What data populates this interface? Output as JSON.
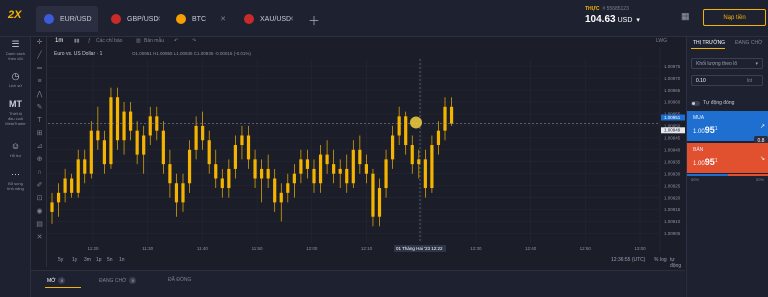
{
  "app": {
    "logo": "2X"
  },
  "tabs": [
    {
      "label": "EUR/USD",
      "flag_color": "#3b5bdb",
      "active": true
    },
    {
      "label": "GBP/USD",
      "flag_color": "#c92a2a",
      "active": false
    },
    {
      "label": "BTC",
      "flag_color": "#f59f00",
      "active": false
    },
    {
      "label": "XAU/USD",
      "flag_color": "#c92a2a",
      "active": false
    }
  ],
  "account": {
    "mode": "THỰC",
    "id": "# 55685123",
    "balance": "104.63",
    "currency": "USD",
    "deposit_label": "Nạp tiền"
  },
  "sidebar": [
    {
      "icon": "list-icon",
      "glyph": "☰",
      "label1": "Danh sách",
      "label2": "theo dõi"
    },
    {
      "icon": "history-icon",
      "glyph": "◷",
      "label1": "Lịch sử",
      "label2": ""
    },
    {
      "icon": "metatrader-icon",
      "glyph": "MT",
      "label1": "Thiết bị",
      "label2": "đầu cuối MetaTrader"
    },
    {
      "icon": "support-icon",
      "glyph": "☺",
      "label1": "Hỗ trợ",
      "label2": ""
    },
    {
      "icon": "more-icon",
      "glyph": "⋯",
      "label1": "Bổ sung",
      "label2": "tính năng"
    }
  ],
  "chart_toolbar": {
    "timeframe": "1m",
    "chart_style": "Các chỉ báo",
    "templates": "Bản mẫu",
    "ohlc": "O1.00951 H1.00955 L1.00935 C1.00935 -0.00015 (-0.01%)",
    "symbol_name": "Euro vs. US Dollar · 1",
    "log_label": "LWG"
  },
  "chart_data": {
    "type": "candlestick",
    "symbol": "Euro vs. US Dollar",
    "interval": "1",
    "y_ticks": [
      "1.00975",
      "1.00970",
      "1.00965",
      "1.00960",
      "1.00955",
      "1.00950",
      "1.00945",
      "1.00940",
      "1.00935",
      "1.00930",
      "1.00925",
      "1.00920",
      "1.00915",
      "1.00910",
      "1.00905"
    ],
    "x_ticks": [
      "11:20",
      "11:30",
      "11:40",
      "11:50",
      "12:00",
      "12:10",
      "12:20",
      "12:30",
      "12:40",
      "12:50",
      "13:00"
    ],
    "ylim": [
      1.00901,
      1.00978
    ],
    "current_price_label": "1.00949",
    "crosshair_price_label": "1.00951",
    "crosshair_time_label": "01 Tháng Hai '23",
    "crosshair_time2": "12:22",
    "candle_color": "#f4b400",
    "ohlc": [
      [
        1.00914,
        1.00922,
        1.00909,
        1.00918
      ],
      [
        1.00918,
        1.00926,
        1.00912,
        1.00922
      ],
      [
        1.00922,
        1.00932,
        1.00918,
        1.00928
      ],
      [
        1.00928,
        1.0093,
        1.0092,
        1.00922
      ],
      [
        1.00922,
        1.0094,
        1.0092,
        1.00936
      ],
      [
        1.00936,
        1.0094,
        1.00926,
        1.0093
      ],
      [
        1.0093,
        1.00952,
        1.00928,
        1.00948
      ],
      [
        1.00948,
        1.00958,
        1.0094,
        1.00944
      ],
      [
        1.00944,
        1.00948,
        1.0093,
        1.00934
      ],
      [
        1.00934,
        1.00966,
        1.00932,
        1.00962
      ],
      [
        1.00962,
        1.00966,
        1.0094,
        1.00944
      ],
      [
        1.00944,
        1.0096,
        1.00938,
        1.00956
      ],
      [
        1.00956,
        1.0096,
        1.00944,
        1.00948
      ],
      [
        1.00948,
        1.00952,
        1.00934,
        1.00938
      ],
      [
        1.00938,
        1.0095,
        1.0093,
        1.00946
      ],
      [
        1.00946,
        1.00958,
        1.00942,
        1.00954
      ],
      [
        1.00954,
        1.00958,
        1.00944,
        1.00948
      ],
      [
        1.00948,
        1.00952,
        1.0093,
        1.00934
      ],
      [
        1.00934,
        1.0094,
        1.0092,
        1.00926
      ],
      [
        1.00926,
        1.0093,
        1.00912,
        1.00918
      ],
      [
        1.00918,
        1.0093,
        1.00914,
        1.00926
      ],
      [
        1.00926,
        1.00944,
        1.00922,
        1.0094
      ],
      [
        1.0094,
        1.00954,
        1.00936,
        1.0095
      ],
      [
        1.0095,
        1.00956,
        1.0094,
        1.00944
      ],
      [
        1.00944,
        1.00948,
        1.0093,
        1.00934
      ],
      [
        1.00934,
        1.0094,
        1.00924,
        1.00928
      ],
      [
        1.00928,
        1.00932,
        1.0092,
        1.00924
      ],
      [
        1.00924,
        1.00936,
        1.0092,
        1.00932
      ],
      [
        1.00932,
        1.00946,
        1.00928,
        1.00942
      ],
      [
        1.00942,
        1.0095,
        1.00936,
        1.00946
      ],
      [
        1.00946,
        1.0095,
        1.00932,
        1.00936
      ],
      [
        1.00936,
        1.0094,
        1.00924,
        1.00928
      ],
      [
        1.00928,
        1.00936,
        1.00918,
        1.00932
      ],
      [
        1.00932,
        1.00938,
        1.00924,
        1.00928
      ],
      [
        1.00928,
        1.00932,
        1.00914,
        1.00918
      ],
      [
        1.00918,
        1.00926,
        1.0091,
        1.00922
      ],
      [
        1.00922,
        1.0093,
        1.00918,
        1.00926
      ],
      [
        1.00926,
        1.00934,
        1.0092,
        1.0093
      ],
      [
        1.0093,
        1.0094,
        1.00926,
        1.00936
      ],
      [
        1.00936,
        1.0094,
        1.00928,
        1.00932
      ],
      [
        1.00932,
        1.00936,
        1.00922,
        1.00926
      ],
      [
        1.00926,
        1.00942,
        1.00922,
        1.00938
      ],
      [
        1.00938,
        1.00944,
        1.0093,
        1.00934
      ],
      [
        1.00934,
        1.0094,
        1.00926,
        1.0093
      ],
      [
        1.0093,
        1.00936,
        1.00924,
        1.00932
      ],
      [
        1.00932,
        1.00938,
        1.00922,
        1.00926
      ],
      [
        1.00926,
        1.00944,
        1.00924,
        1.0094
      ],
      [
        1.0094,
        1.00946,
        1.0093,
        1.00934
      ],
      [
        1.00934,
        1.00938,
        1.00926,
        1.0093
      ],
      [
        1.0093,
        1.00932,
        1.00908,
        1.00912
      ],
      [
        1.00912,
        1.00928,
        1.00908,
        1.00924
      ],
      [
        1.00924,
        1.0094,
        1.0092,
        1.00936
      ],
      [
        1.00936,
        1.0095,
        1.00932,
        1.00946
      ],
      [
        1.00946,
        1.00958,
        1.00942,
        1.00954
      ],
      [
        1.00954,
        1.00956,
        1.00938,
        1.00942
      ],
      [
        1.00942,
        1.00946,
        1.0093,
        1.00934
      ],
      [
        1.00934,
        1.0094,
        1.00928,
        1.00936
      ],
      [
        1.00936,
        1.0094,
        1.0092,
        1.00924
      ],
      [
        1.00924,
        1.00946,
        1.00922,
        1.00942
      ],
      [
        1.00942,
        1.00952,
        1.00938,
        1.00948
      ],
      [
        1.00948,
        1.00962,
        1.00944,
        1.00958
      ],
      [
        1.00958,
        1.00962,
        1.0095,
        1.00951
      ]
    ]
  },
  "bottom_timeframes": [
    "5y",
    "1y",
    "3m",
    "1p",
    "5n",
    "1n"
  ],
  "bottom_right": {
    "time": "12:36:55 (UTC)",
    "scale": "%",
    "log": "log",
    "auto": "tự động"
  },
  "bottom_tabs": [
    {
      "label": "MỞ",
      "count": "0",
      "active": true
    },
    {
      "label": "ĐANG CHỜ",
      "count": "0",
      "active": false
    },
    {
      "label": "ĐÃ ĐÓNG",
      "count": "",
      "active": false
    }
  ],
  "right_panel": {
    "tab_market": "THỊ TRƯỜNG",
    "tab_pending": "ĐANG CHỜ",
    "volume_label": "Khối lượng theo lô",
    "volume_value": "0.10",
    "volume_unit": "lot",
    "auto_close": "Tự động đóng",
    "buy_label": "MUA",
    "buy_price": "1.00",
    "buy_price_big": "95",
    "buy_price_small": "1",
    "sell_label": "BÁN",
    "sell_price": "1.00",
    "sell_price_big": "95",
    "sell_price_small": "1",
    "spread": "0.8",
    "ratio_buy": "50%",
    "ratio_sell": "50%",
    "ratio_buy_frac": 0.5,
    "buy_color": "#1f6fd1",
    "sell_color": "#e1502f"
  }
}
